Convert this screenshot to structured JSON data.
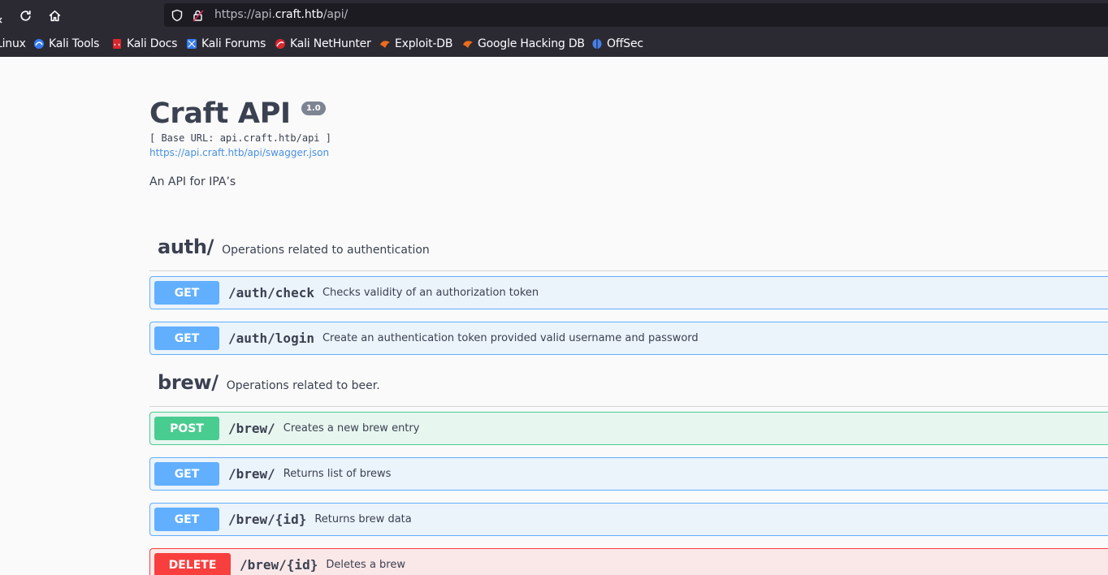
{
  "browser": {
    "url_prefix": "https://api.",
    "url_domain": "craft.htb",
    "url_suffix": "/api/",
    "bookmarks": [
      {
        "label": "Linux",
        "icon": "kali-linux-icon"
      },
      {
        "label": "Kali Tools",
        "icon": "kali-tools-icon"
      },
      {
        "label": "Kali Docs",
        "icon": "kali-docs-icon"
      },
      {
        "label": "Kali Forums",
        "icon": "kali-forums-icon"
      },
      {
        "label": "Kali NetHunter",
        "icon": "kali-nethunter-icon"
      },
      {
        "label": "Exploit-DB",
        "icon": "exploit-db-icon"
      },
      {
        "label": "Google Hacking DB",
        "icon": "google-hacking-db-icon"
      },
      {
        "label": "OffSec",
        "icon": "offsec-icon"
      }
    ]
  },
  "api": {
    "title": "Craft API",
    "version": "1.0",
    "base_url": "[ Base URL: api.craft.htb/api ]",
    "spec_url": "https://api.craft.htb/api/swagger.json",
    "description": "An API for IPA’s"
  },
  "tags": [
    {
      "name": "auth/",
      "description": "Operations related to authentication",
      "operations": [
        {
          "method": "GET",
          "path": "/auth/check",
          "summary": "Checks validity of an authorization token"
        },
        {
          "method": "GET",
          "path": "/auth/login",
          "summary": "Create an authentication token provided valid username and password"
        }
      ]
    },
    {
      "name": "brew/",
      "description": "Operations related to beer.",
      "operations": [
        {
          "method": "POST",
          "path": "/brew/",
          "summary": "Creates a new brew entry"
        },
        {
          "method": "GET",
          "path": "/brew/",
          "summary": "Returns list of brews"
        },
        {
          "method": "GET",
          "path": "/brew/{id}",
          "summary": "Returns brew data"
        },
        {
          "method": "DELETE",
          "path": "/brew/{id}",
          "summary": "Deletes a brew"
        }
      ]
    }
  ],
  "colors": {
    "get": "#61affe",
    "post": "#49cc90",
    "delete": "#f93e3e",
    "link": "#4990e2",
    "text": "#3b4151"
  }
}
